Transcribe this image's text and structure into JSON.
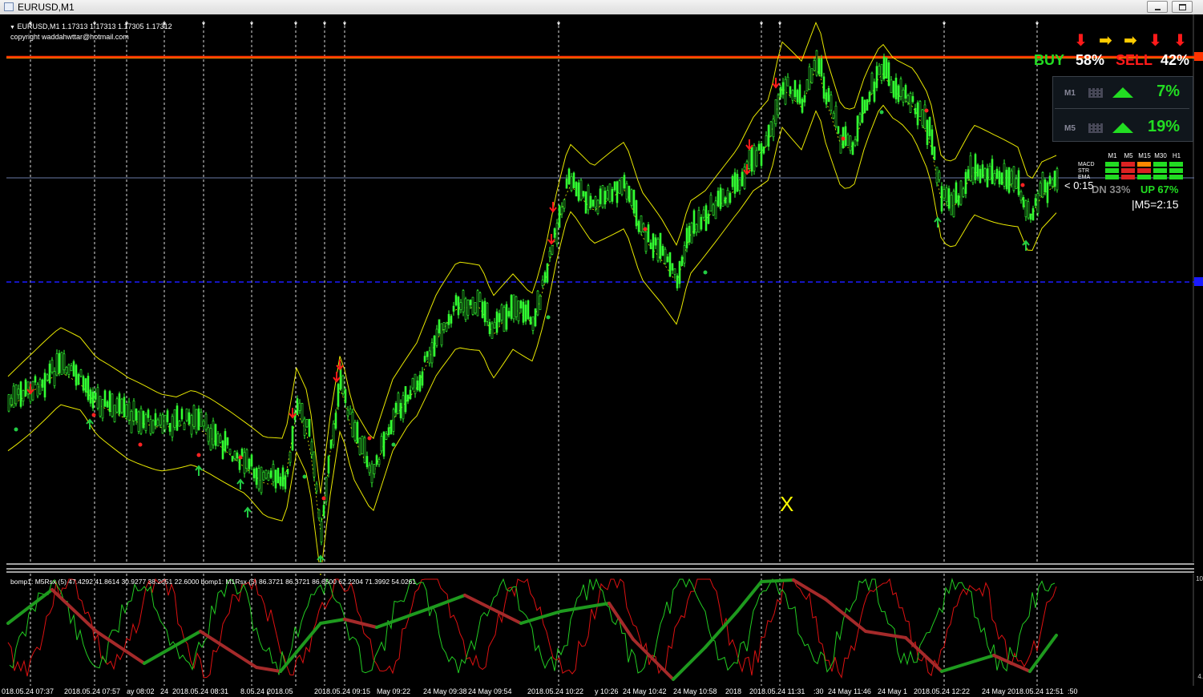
{
  "window": {
    "title": "EURUSD,M1"
  },
  "chart": {
    "header_line": "EURUSD,M1  1.17313 1.17313 1.17305 1.17312",
    "copyright": "copyright waddahwttar@hotmail.com",
    "timer": "< 0:15",
    "m5_timer": "|M5=2:15",
    "cross_marker": "X"
  },
  "signals": {
    "buy_label": "BUY",
    "buy_pct": "58%",
    "sell_label": "SELL",
    "sell_pct": "42%",
    "arrows": [
      "down",
      "right",
      "right",
      "down",
      "down"
    ],
    "arrow_colors": {
      "down": "#ff1a1a",
      "right": "#ffcc00"
    }
  },
  "strength_panel": [
    {
      "tf": "M1",
      "value": "7%",
      "direction": "up"
    },
    {
      "tf": "M5",
      "value": "19%",
      "direction": "up"
    }
  ],
  "trend_matrix": {
    "columns": [
      "M1",
      "M5",
      "M15",
      "M30",
      "H1"
    ],
    "rows": [
      "MACD",
      "STR",
      "EMA"
    ],
    "cells": [
      [
        "#22dd22",
        "#dd2222",
        "#ff8800",
        "#22dd22",
        "#22dd22"
      ],
      [
        "#22dd22",
        "#dd2222",
        "#dd2222",
        "#22dd22",
        "#22dd22"
      ],
      [
        "#22dd22",
        "#dd2222",
        "#22dd22",
        "#22dd22",
        "#22dd22"
      ]
    ],
    "dn_text": "DN 33%",
    "up_text": "UP 67%"
  },
  "sub_indicator": {
    "label": "bomp1: M5Rsx (5) 47.4292 41.8614 30.9277 38.2051 22.6000  bomp1: M1Rsx (5) 86.3721 86.3721 86.6500 62.2204 71.3992 54.0261",
    "scale_top": "10",
    "scale_bottom": "4."
  },
  "time_axis": [
    "018.05.24 07:37",
    "2018.05.24 07:57",
    "ay 08:02",
    "24",
    "2018.05.24 08:31",
    "8.05.24 (",
    "2018.05",
    "2018.05.24 09:15",
    "May 09:22",
    "24 May 09:38",
    "24 May 09:54",
    "2018.05.24 10:22",
    "y 10:26",
    "24 May 10:42",
    "24 May 10:58",
    "2018",
    "2018.05.24 11:31",
    ":30",
    "24 May 11:46",
    "24 May 1",
    "2018.05.24 12:22",
    "24 May",
    "2018.05.24 12:51",
    ":50"
  ],
  "colors": {
    "background": "#000000",
    "bull_candle": "#33ff33",
    "bands": "#e8e800",
    "resistance_line": "#ff3300",
    "support_line": "#1a1aff",
    "price_line": "#6a7aa8"
  }
}
